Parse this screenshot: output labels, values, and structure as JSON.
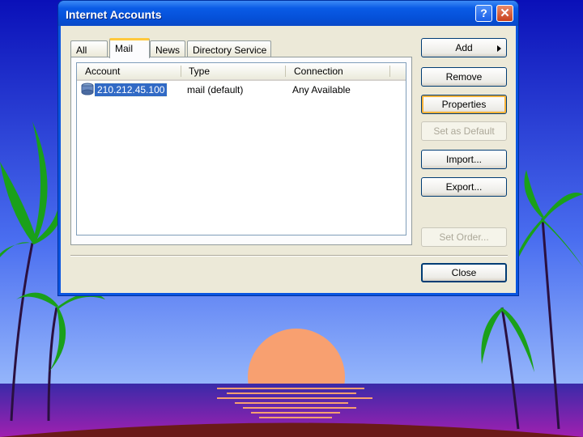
{
  "window": {
    "title": "Internet Accounts",
    "help_label": "?",
    "close_label": "✕"
  },
  "tabs": [
    {
      "label": "All"
    },
    {
      "label": "Mail"
    },
    {
      "label": "News"
    },
    {
      "label": "Directory Service"
    }
  ],
  "active_tab": "Mail",
  "list": {
    "columns": [
      "Account",
      "Type",
      "Connection"
    ],
    "rows": [
      {
        "account": "210.212.45.100",
        "type": "mail (default)",
        "connection": "Any Available"
      }
    ]
  },
  "buttons": {
    "add": "Add",
    "remove": "Remove",
    "properties": "Properties",
    "set_default": "Set as Default",
    "import": "Import...",
    "export": "Export...",
    "set_order": "Set Order...",
    "close": "Close"
  },
  "colors": {
    "sky_top": "#0a10b8",
    "sky_bottom": "#a8c8ff",
    "sun": "#f8a070",
    "sea": "#7020a0",
    "titlebar": "#0a55e0"
  }
}
